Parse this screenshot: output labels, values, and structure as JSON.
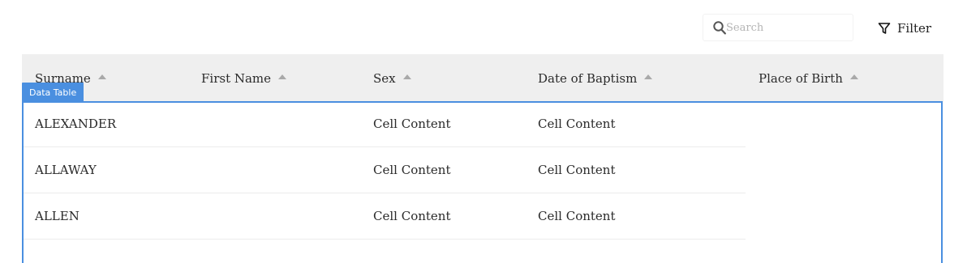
{
  "search": {
    "placeholder": "Search"
  },
  "filter": {
    "label": "Filter"
  },
  "table": {
    "selection_label": "Data Table",
    "columns": [
      "Surname",
      "First Name",
      "Sex",
      "Date of Baptism",
      "Place of Birth"
    ],
    "rows": [
      {
        "surname": "ALEXANDER",
        "first_name": "",
        "sex": "Cell Content",
        "date_of_baptism": "Cell Content"
      },
      {
        "surname": "ALLAWAY",
        "first_name": "",
        "sex": "Cell Content",
        "date_of_baptism": "Cell Content"
      },
      {
        "surname": "ALLEN",
        "first_name": "",
        "sex": "Cell Content",
        "date_of_baptism": "Cell Content"
      }
    ]
  },
  "colors": {
    "header_bg": "#efefef",
    "selection": "#4a8fe0",
    "sort_caret": "#a9a9a9"
  },
  "icons": {
    "search": "search-icon",
    "filter": "filter-icon",
    "sort": "sort-ascending-icon"
  }
}
